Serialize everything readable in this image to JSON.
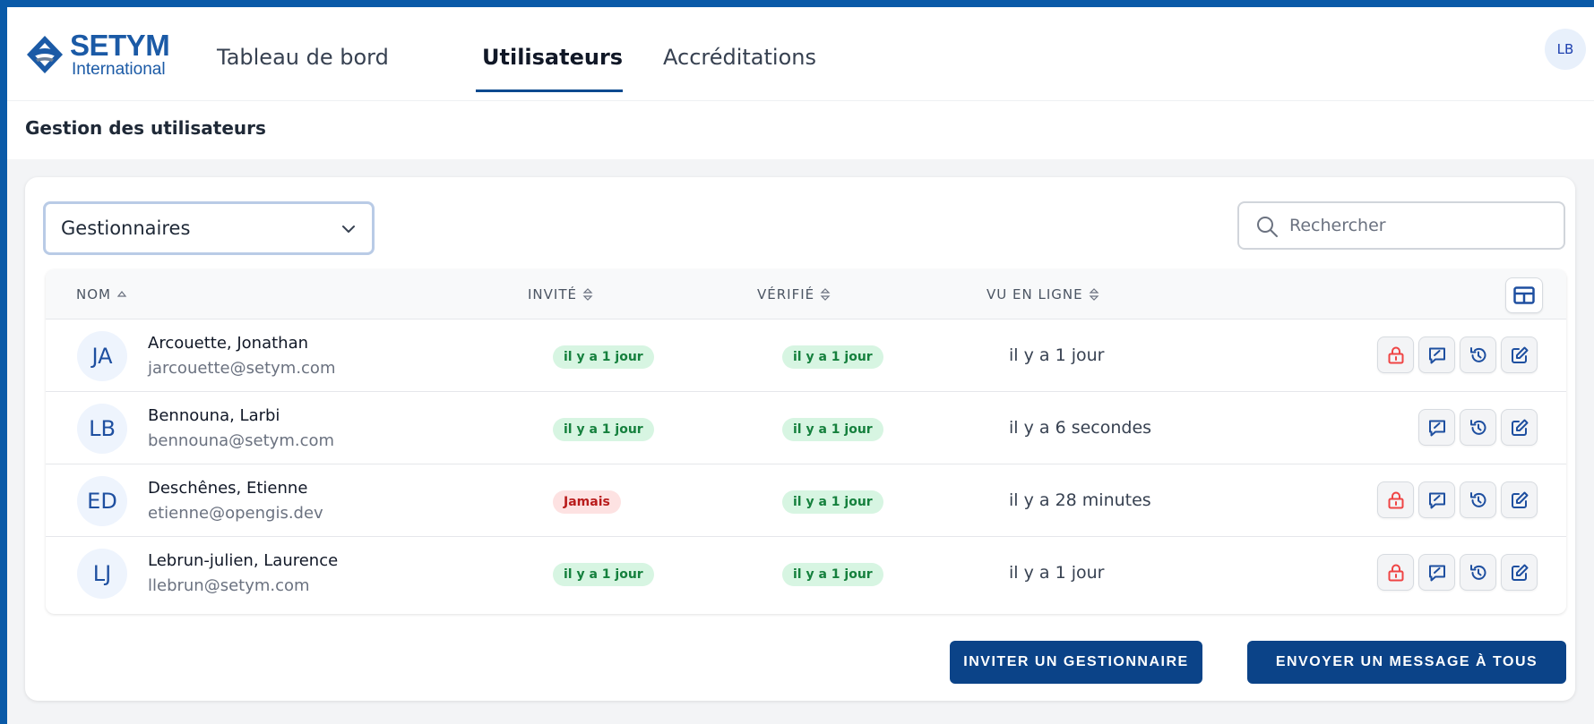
{
  "brand": {
    "name": "SETYM",
    "sub": "International"
  },
  "nav": {
    "tabs": [
      {
        "label": "Tableau de bord"
      },
      {
        "label": "Utilisateurs"
      },
      {
        "label": "Accréditations"
      }
    ],
    "user_initials": "LB"
  },
  "page": {
    "subtitle": "Gestion des utilisateurs"
  },
  "filter": {
    "selected": "Gestionnaires"
  },
  "search": {
    "placeholder": "Rechercher"
  },
  "table": {
    "headers": {
      "name": "NOM",
      "invited": "INVITÉ",
      "verified": "VÉRIFIÉ",
      "online": "VU EN LIGNE"
    },
    "rows": [
      {
        "initials": "JA",
        "name": "Arcouette, Jonathan",
        "email": "jarcouette@setym.com",
        "invited": "il y a 1 jour",
        "verified": "il y a 1 jour",
        "seen": "il y a 1 jour"
      },
      {
        "initials": "LB",
        "name": "Bennouna, Larbi",
        "email": "bennouna@setym.com",
        "invited": "il y a 1 jour",
        "verified": "il y a 1 jour",
        "seen": "il y a 6 secondes"
      },
      {
        "initials": "ED",
        "name": "Deschênes, Etienne",
        "email": "etienne@opengis.dev",
        "invited": "Jamais",
        "verified": "il y a 1 jour",
        "seen": "il y a 28 minutes"
      },
      {
        "initials": "LJ",
        "name": "Lebrun-julien, Laurence",
        "email": "llebrun@setym.com",
        "invited": "il y a 1 jour",
        "verified": "il y a 1 jour",
        "seen": "il y a 1 jour"
      }
    ]
  },
  "buttons": {
    "invite": "INVITER UN GESTIONNAIRE",
    "message_all": "ENVOYER UN MESSAGE À TOUS"
  },
  "colors": {
    "accent": "#0b4388",
    "badge_green_bg": "#d7f5e2",
    "badge_red_bg": "#fde2e2",
    "lock_red": "#ef4444"
  }
}
